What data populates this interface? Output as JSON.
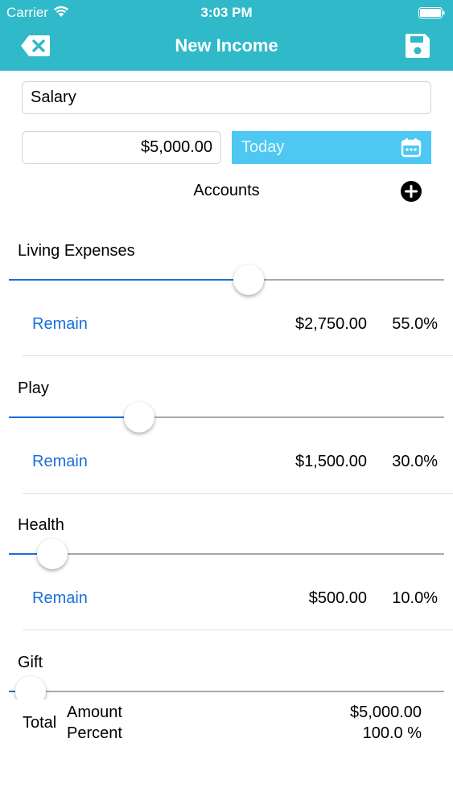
{
  "status_bar": {
    "carrier": "Carrier",
    "time": "3:03 PM"
  },
  "header": {
    "title": "New Income",
    "back_icon": "close-x-tag-icon",
    "save_icon": "save-disk-icon"
  },
  "form": {
    "name_value": "Salary",
    "amount_value": "$5,000.00",
    "date_label": "Today",
    "date_icon": "calendar-icon"
  },
  "accounts_header": {
    "label": "Accounts",
    "add_icon": "plus-circle-icon"
  },
  "accounts": [
    {
      "name": "Living Expenses",
      "remain_label": "Remain",
      "amount": "$2,750.00",
      "percent": "55.0%",
      "slider_value": 0.55
    },
    {
      "name": "Play",
      "remain_label": "Remain",
      "amount": "$1,500.00",
      "percent": "30.0%",
      "slider_value": 0.3
    },
    {
      "name": "Health",
      "remain_label": "Remain",
      "amount": "$500.00",
      "percent": "10.0%",
      "slider_value": 0.1
    },
    {
      "name": "Gift",
      "slider_value": 0.05
    }
  ],
  "totals": {
    "total_label": "Total",
    "amount_label": "Amount",
    "percent_label": "Percent",
    "amount_value": "$5,000.00",
    "percent_value": "100.0 %"
  },
  "colors": {
    "header": "#2fb9c9",
    "accent": "#1a6fd8",
    "date_button": "#4ec8f2"
  }
}
